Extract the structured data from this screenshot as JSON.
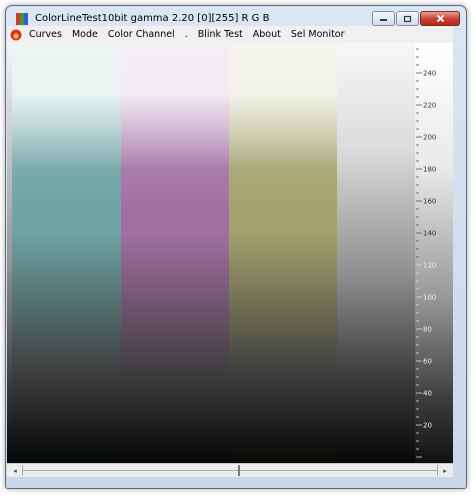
{
  "window": {
    "title": "ColorLineTest10bit gamma 2.20 [0][255]   R G B"
  },
  "menu": {
    "items": [
      "Curves",
      "Mode",
      "Color Channel",
      ".",
      "Blink Test",
      "About",
      "Sel Monitor"
    ]
  },
  "bars": [
    {
      "name": "cyan-bar",
      "top": "#e3eeee",
      "mid": "#6fa3a4",
      "bottom": "#050808"
    },
    {
      "name": "magenta-bar",
      "top": "#eee4ee",
      "mid": "#a36fa3",
      "bottom": "#080508"
    },
    {
      "name": "yellow-bar",
      "top": "#eeeee3",
      "mid": "#a3a36f",
      "bottom": "#080805"
    }
  ],
  "scale": {
    "labels": [
      "240",
      "220",
      "200",
      "180",
      "160",
      "140",
      "120",
      "100",
      "80",
      "60",
      "40",
      "20"
    ],
    "max": 255
  },
  "colors": {
    "window_frame": "#c9d7e8",
    "close_button": "#c7473a",
    "menubar": "#f0f0f0"
  }
}
